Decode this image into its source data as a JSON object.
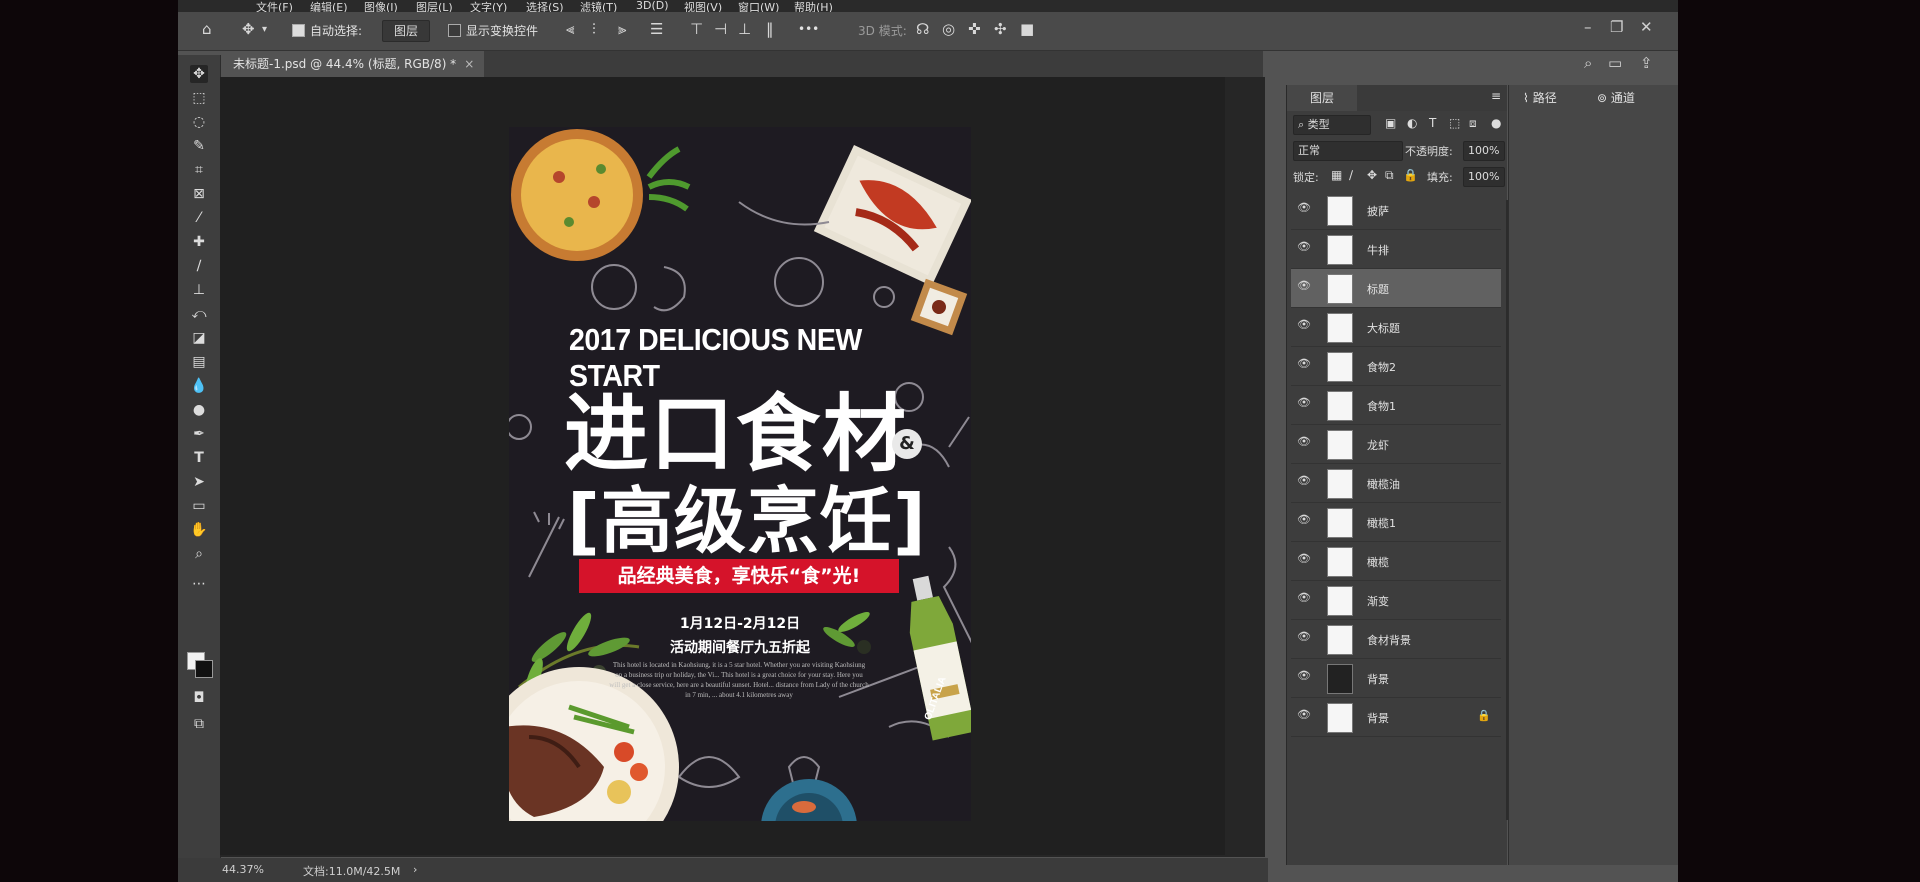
{
  "menu": [
    "文件(F)",
    "编辑(E)",
    "图像(I)",
    "图层(L)",
    "文字(Y)",
    "选择(S)",
    "滤镜(T)",
    "3D(D)",
    "视图(V)",
    "窗口(W)",
    "帮助(H)"
  ],
  "options_bar": {
    "auto_select_label": "自动选择:",
    "auto_select_value": "图层",
    "show_transform_label": "显示变换控件",
    "mode_3d_label": "3D 模式:",
    "more": "•••"
  },
  "doc_tab": {
    "title": "未标题-1.psd @ 44.4% (标题, RGB/8) *",
    "close": "×"
  },
  "status": {
    "zoom": "44.37%",
    "doc_size": "文档:11.0M/42.5M",
    "arrow": "›"
  },
  "poster": {
    "year_line": "2017 DELICIOUS NEW START",
    "title1": "进口食材",
    "amp": "&",
    "title2": "[高级烹饪]",
    "banner": "品经典美食，享快乐“食”光!",
    "date": "1月12日-2月12日",
    "activity": "活动期间餐厅九五折起",
    "small_text": "This hotel is located in Kaohsiung, it is a 5 star hotel. Whether you are visiting Kaohsiung on a business trip or holiday, the Vi... This hotel is a great choice for your stay. Here you will get a close service, here are a beautiful sunset. Hotel... distance from Lady of the church in 7 min, ... about 4.1 kilometres away",
    "bottle_label": "OLITALIA"
  },
  "layers_panel": {
    "tab": "图层",
    "filter": "类型",
    "blend_mode": "正常",
    "opacity_label": "不透明度:",
    "opacity_value": "100%",
    "lock_label": "锁定:",
    "fill_label": "填充:",
    "fill_value": "100%",
    "layers": [
      {
        "name": "披萨"
      },
      {
        "name": "牛排"
      },
      {
        "name": "标题",
        "selected": true
      },
      {
        "name": "大标题"
      },
      {
        "name": "食物2"
      },
      {
        "name": "食物1"
      },
      {
        "name": "龙虾"
      },
      {
        "name": "橄榄油"
      },
      {
        "name": "橄榄1"
      },
      {
        "name": "橄榄"
      },
      {
        "name": "渐变"
      },
      {
        "name": "食材背景"
      },
      {
        "name": "背景",
        "dark": true
      },
      {
        "name": "背景",
        "locked": true
      }
    ]
  },
  "side_panels": {
    "paths": "路径",
    "channels": "通道"
  }
}
